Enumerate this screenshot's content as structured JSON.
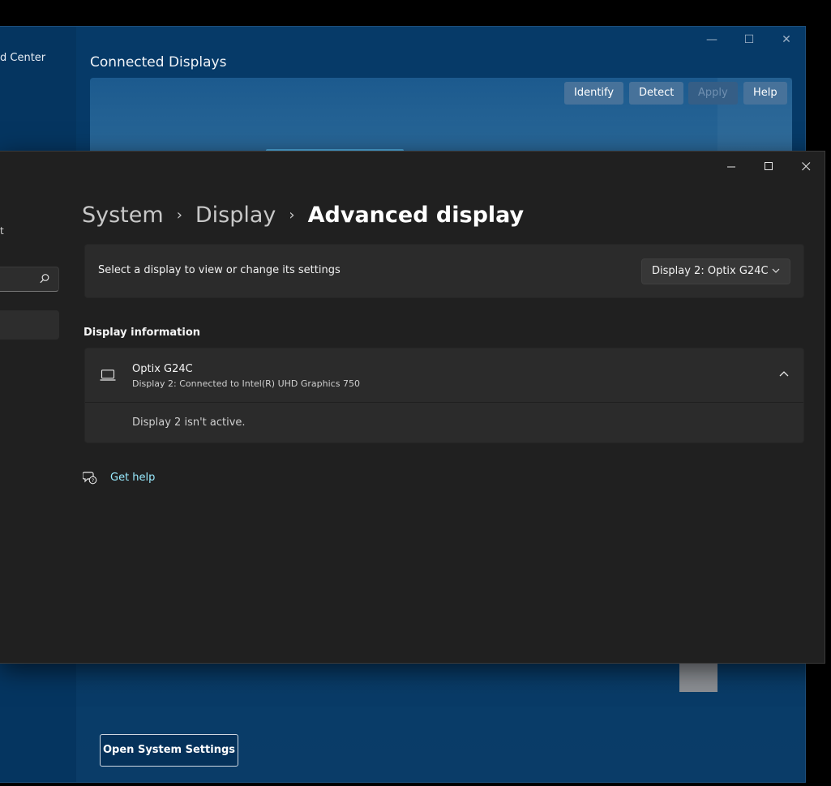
{
  "background_window": {
    "app_title": "d Center",
    "heading": "Connected Displays",
    "buttons": {
      "identify": "Identify",
      "detect": "Detect",
      "apply": "Apply",
      "help": "Help"
    },
    "open_settings_label": "Open System Settings"
  },
  "settings": {
    "sidebar_fragment": "t",
    "breadcrumb": {
      "system": "System",
      "display": "Display",
      "current": "Advanced display"
    },
    "select_card": {
      "label": "Select a display to view or change its settings",
      "selected_display": "Display 2: Optix G24C"
    },
    "display_info": {
      "section_title": "Display information",
      "name": "Optix G24C",
      "connection": "Display 2: Connected to Intel(R) UHD Graphics 750",
      "status": "Display 2 isn't active."
    },
    "get_help_label": "Get help"
  },
  "colors": {
    "accent_link": "#99ebff",
    "bg_blue": "#063a68",
    "settings_bg": "#202020"
  }
}
